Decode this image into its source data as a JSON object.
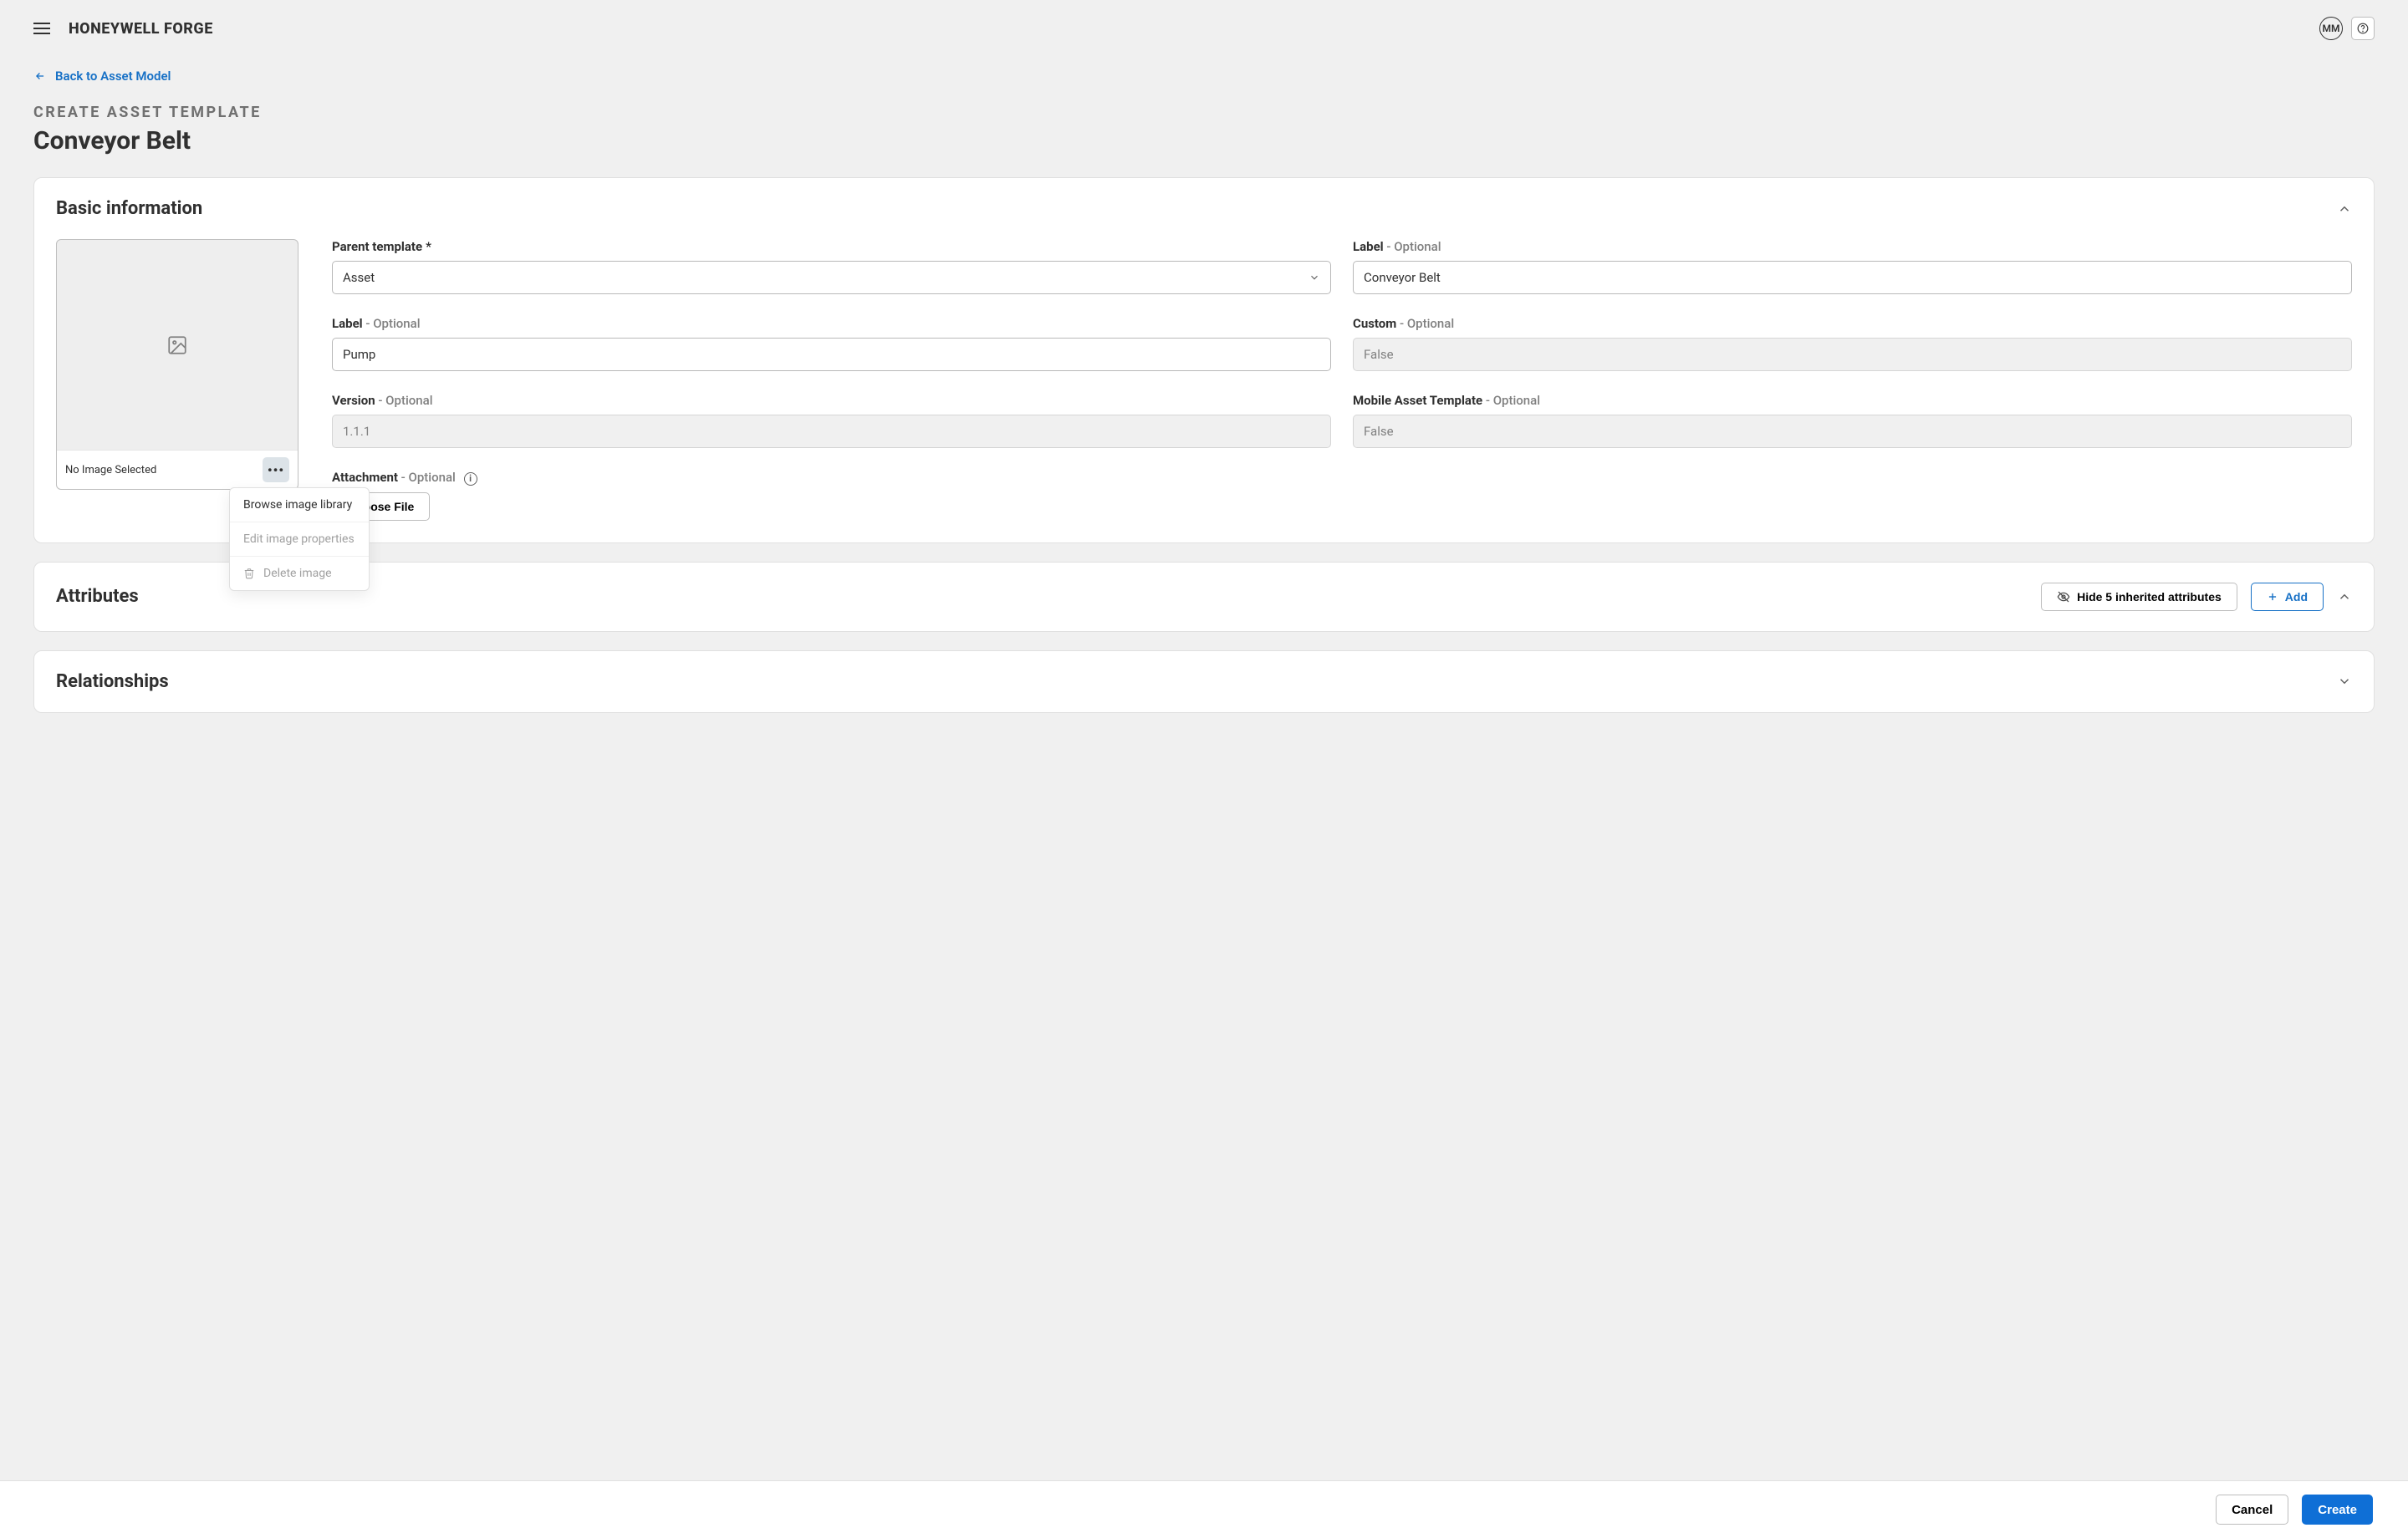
{
  "app": {
    "brand": "HONEYWELL FORGE"
  },
  "user": {
    "initials": "MM"
  },
  "nav": {
    "back_label": "Back to Asset Model"
  },
  "page": {
    "eyebrow": "CREATE ASSET TEMPLATE",
    "title": "Conveyor Belt"
  },
  "basic": {
    "section_title": "Basic information",
    "image": {
      "placeholder": "No Image Selected",
      "menu": {
        "browse": "Browse image library",
        "edit": "Edit image properties",
        "delete": "Delete image"
      }
    },
    "fields": {
      "parent_template": {
        "label": "Parent template",
        "value": "Asset",
        "required": true
      },
      "label_right": {
        "label": "Label",
        "optional": "- Optional",
        "value": "Conveyor Belt"
      },
      "label_left": {
        "label": "Label",
        "optional": "- Optional",
        "value": "Pump"
      },
      "custom": {
        "label": "Custom",
        "optional": "- Optional",
        "value": "False"
      },
      "version": {
        "label": "Version",
        "optional": "- Optional",
        "value": "1.1.1"
      },
      "mobile": {
        "label": "Mobile Asset Template",
        "optional": "- Optional",
        "value": "False"
      },
      "attachment": {
        "label": "Attachment",
        "optional": "- Optional",
        "button": "Choose File"
      }
    }
  },
  "attributes": {
    "section_title": "Attributes",
    "hide_label": "Hide 5 inherited attributes",
    "add_label": "Add"
  },
  "relationships": {
    "section_title": "Relationships"
  },
  "footer": {
    "cancel": "Cancel",
    "create": "Create"
  }
}
